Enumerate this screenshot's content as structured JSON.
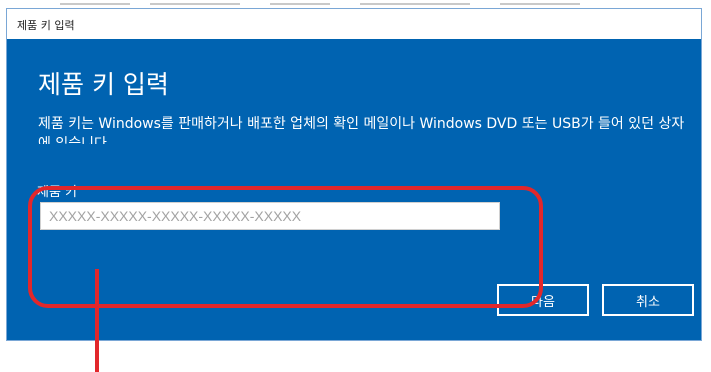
{
  "window": {
    "title": "제품 키 입력"
  },
  "dialog": {
    "heading": "제품 키 입력",
    "description": "제품 키는 Windows를 판매하거나 배포한 업체의 확인 메일이나 Windows DVD 또는 USB가 들어 있던 상자에 있습니다.",
    "product_key_label": "제품 키",
    "product_key_placeholder": "XXXXX-XXXXX-XXXXX-XXXXX-XXXXX",
    "product_key_value": ""
  },
  "buttons": {
    "next": "다음",
    "cancel": "취소"
  },
  "colors": {
    "dialog_background": "#0063b1",
    "highlight_annotation": "#e2272b",
    "text": "#ffffff"
  }
}
